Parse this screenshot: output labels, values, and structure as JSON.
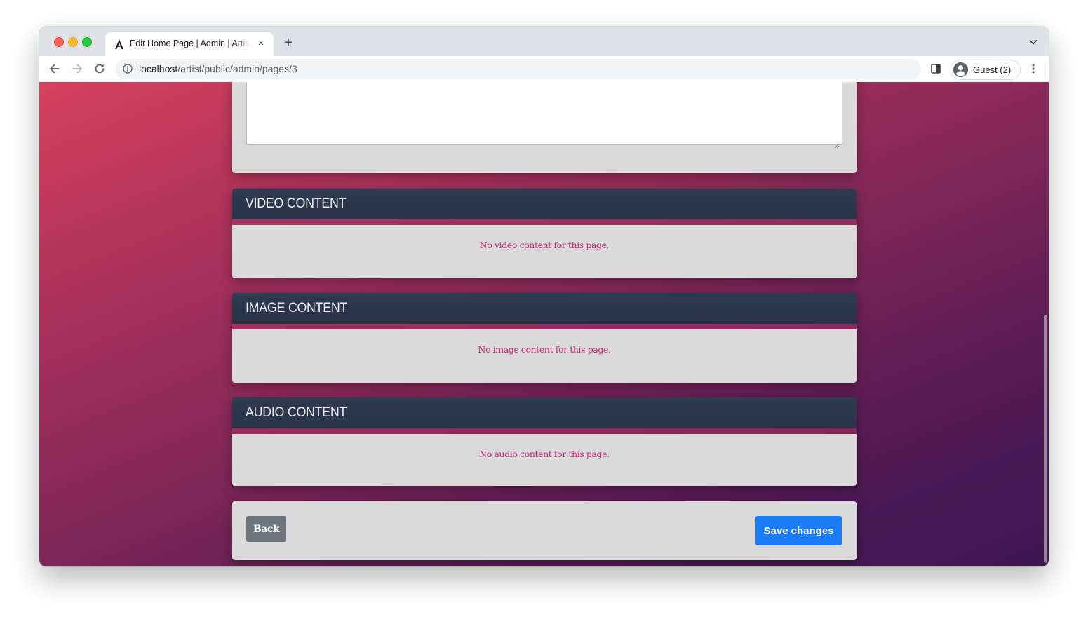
{
  "browser": {
    "tab_title": "Edit Home Page | Admin | Artist",
    "tab_close_glyph": "×",
    "new_tab_glyph": "+",
    "url_host": "localhost",
    "url_path": "/artist/public/admin/pages/3",
    "profile_label": "Guest (2)"
  },
  "page": {
    "sections": {
      "video": {
        "title": "VIDEO CONTENT",
        "empty_message": "No video content for this page."
      },
      "image": {
        "title": "IMAGE CONTENT",
        "empty_message": "No image content for this page."
      },
      "audio": {
        "title": "AUDIO CONTENT",
        "empty_message": "No audio content for this page."
      }
    },
    "actions": {
      "back_label": "Back",
      "save_label": "Save changes"
    }
  },
  "colors": {
    "section_header": "#2d364b",
    "empty_message": "#c8267a",
    "back_button": "#6c757d",
    "save_button": "#1a7cf5"
  },
  "icons": [
    "favicon-a-icon",
    "close-icon",
    "plus-icon",
    "chevron-down-icon",
    "back-arrow-icon",
    "forward-arrow-icon",
    "reload-icon",
    "info-icon",
    "side-panel-icon",
    "avatar-icon",
    "kebab-menu-icon",
    "resize-grip-icon"
  ]
}
